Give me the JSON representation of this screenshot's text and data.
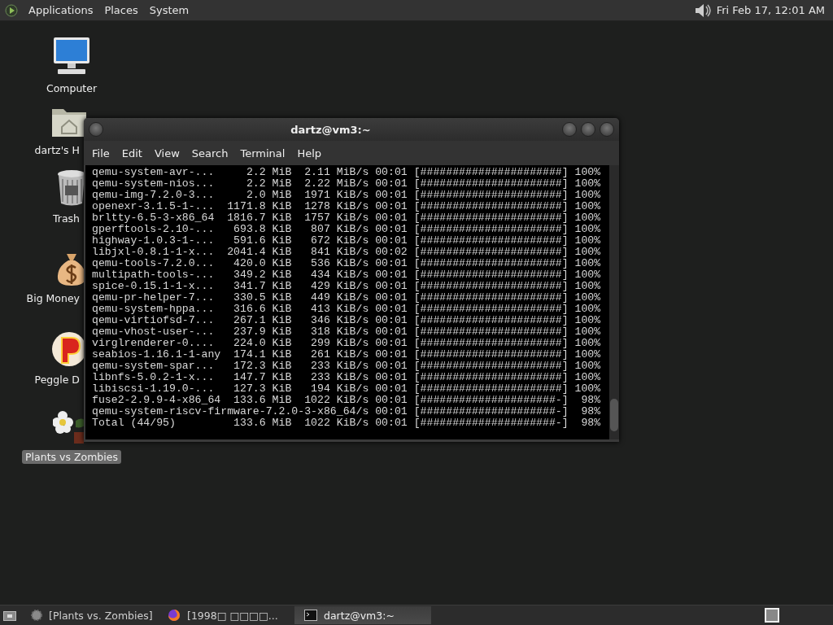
{
  "top_panel": {
    "menus": [
      "Applications",
      "Places",
      "System"
    ],
    "clock": "Fri Feb 17, 12:01 AM"
  },
  "desktop_icons": [
    {
      "kind": "computer",
      "label": "Computer",
      "selected": false
    },
    {
      "kind": "home",
      "label": "dartz's H",
      "selected": false
    },
    {
      "kind": "trash",
      "label": "Trash",
      "selected": false
    },
    {
      "kind": "money",
      "label": "Big Money",
      "selected": false
    },
    {
      "kind": "ball",
      "label": "Peggle D",
      "selected": false
    },
    {
      "kind": "flower",
      "label": "Plants vs Zombies",
      "selected": true
    }
  ],
  "terminal": {
    "title": "dartz@vm3:~",
    "menus": [
      "File",
      "Edit",
      "View",
      "Search",
      "Terminal",
      "Help"
    ],
    "lines": [
      "qemu-system-avr-...     2.2 MiB  2.11 MiB/s 00:01 [######################] 100%",
      "qemu-system-nios...     2.2 MiB  2.22 MiB/s 00:01 [######################] 100%",
      "qemu-img-7.2.0-3...     2.0 MiB  1971 KiB/s 00:01 [######################] 100%",
      "openexr-3.1.5-1-...  1171.8 KiB  1278 KiB/s 00:01 [######################] 100%",
      "brltty-6.5-3-x86_64  1816.7 KiB  1757 KiB/s 00:01 [######################] 100%",
      "gperftools-2.10-...   693.8 KiB   807 KiB/s 00:01 [######################] 100%",
      "highway-1.0.3-1-...   591.6 KiB   672 KiB/s 00:01 [######################] 100%",
      "libjxl-0.8.1-1-x...  2041.4 KiB   841 KiB/s 00:02 [######################] 100%",
      "qemu-tools-7.2.0...   420.0 KiB   536 KiB/s 00:01 [######################] 100%",
      "multipath-tools-...   349.2 KiB   434 KiB/s 00:01 [######################] 100%",
      "spice-0.15.1-1-x...   341.7 KiB   429 KiB/s 00:01 [######################] 100%",
      "qemu-pr-helper-7...   330.5 KiB   449 KiB/s 00:01 [######################] 100%",
      "qemu-system-hppa...   316.6 KiB   413 KiB/s 00:01 [######################] 100%",
      "qemu-virtiofsd-7...   267.1 KiB   346 KiB/s 00:01 [######################] 100%",
      "qemu-vhost-user-...   237.9 KiB   318 KiB/s 00:01 [######################] 100%",
      "virglrenderer-0....   224.0 KiB   299 KiB/s 00:01 [######################] 100%",
      "seabios-1.16.1-1-any  174.1 KiB   261 KiB/s 00:01 [######################] 100%",
      "qemu-system-spar...   172.3 KiB   233 KiB/s 00:01 [######################] 100%",
      "libnfs-5.0.2-1-x...   147.7 KiB   233 KiB/s 00:01 [######################] 100%",
      "libiscsi-1.19.0-...   127.3 KiB   194 KiB/s 00:01 [######################] 100%",
      "fuse2-2.9.9-4-x86_64  133.6 MiB  1022 KiB/s 00:01 [#####################-]  98%",
      "qemu-system-riscv-firmware-7.2.0-3-x86_64/s 00:01 [#####################-]  98%",
      "Total (44/95)         133.6 MiB  1022 KiB/s 00:01 [#####################-]  98%"
    ]
  },
  "taskbar": {
    "tasks": [
      {
        "kind": "game",
        "label": "[Plants vs. Zombies]",
        "selected": false
      },
      {
        "kind": "browser",
        "label": "[1998□ □□□□...",
        "selected": false
      },
      {
        "kind": "terminal",
        "label": "dartz@vm3:~",
        "selected": true
      }
    ]
  }
}
